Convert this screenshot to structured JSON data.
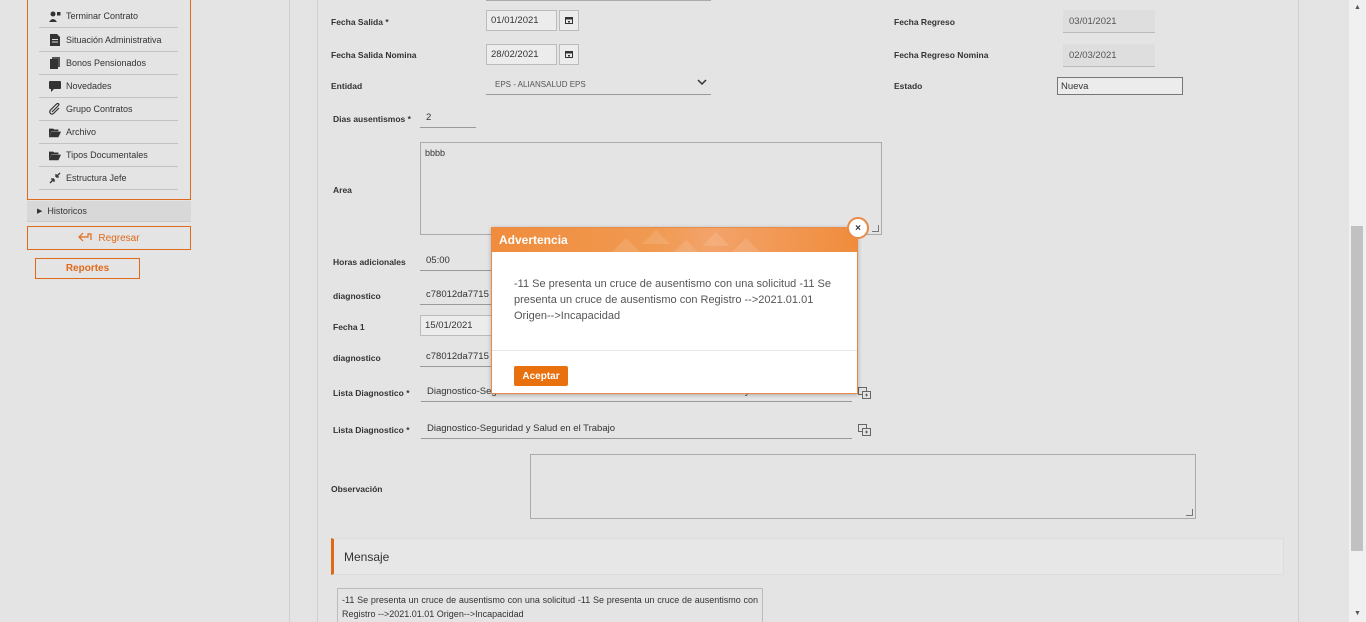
{
  "sidebar": {
    "items": [
      {
        "label": "Terminar Contrato",
        "icon": "person-remove-icon"
      },
      {
        "label": "Situación Administrativa",
        "icon": "document-icon"
      },
      {
        "label": "Bonos Pensionados",
        "icon": "bonds-icon"
      },
      {
        "label": "Novedades",
        "icon": "comment-icon"
      },
      {
        "label": "Grupo Contratos",
        "icon": "paperclip-icon"
      },
      {
        "label": "Archivo",
        "icon": "folder-open-icon"
      },
      {
        "label": "Tipos Documentales",
        "icon": "folder-open-icon"
      },
      {
        "label": "Estructura Jefe",
        "icon": "compress-icon"
      }
    ],
    "historicos": "Historicos",
    "regresar": "Regresar",
    "reportes": "Reportes"
  },
  "form": {
    "fecha_salida_label": "Fecha Salida *",
    "fecha_salida_value": "01/01/2021",
    "fecha_salida_nomina_label": "Fecha Salida Nomina",
    "fecha_salida_nomina_value": "28/02/2021",
    "fecha_regreso_label": "Fecha Regreso",
    "fecha_regreso_value": "03/01/2021",
    "fecha_regreso_nomina_label": "Fecha Regreso Nomina",
    "fecha_regreso_nomina_value": "02/03/2021",
    "entidad_label": "Entidad",
    "entidad_value": "EPS - ALIANSALUD EPS",
    "estado_label": "Estado",
    "estado_value": "Nueva",
    "dias_label": "Dias ausentismos *",
    "dias_value": "2",
    "area_label": "Area",
    "area_value": "bbbb",
    "horas_label": "Horas adicionales",
    "horas_value": "05:00",
    "diagnostico1_label": "diagnostico",
    "diagnostico1_value": "c78012da7715",
    "fecha1_label": "Fecha 1",
    "fecha1_value": "15/01/2021",
    "diagnostico2_label": "diagnostico",
    "diagnostico2_value": "c78012da7715",
    "lista1_label": "Lista Diagnostico *",
    "lista1_value": "Diagnostico-Seg",
    "lista1_value_tail": "y",
    "lista2_label": "Lista Diagnostico *",
    "lista2_value": "Diagnostico-Seguridad y Salud en el Trabajo",
    "observacion_label": "Observación"
  },
  "mensaje": {
    "title": "Mensaje",
    "text": "-11 Se presenta un cruce de ausentismo con una solicitud -11 Se presenta un cruce de ausentismo con    Registro -->2021.01.01     Origen-->Incapacidad"
  },
  "modal": {
    "title": "Advertencia",
    "body": "-11 Se presenta un cruce de ausentismo con una solicitud -11 Se presenta un cruce de ausentismo con Registro -->2021.01.01 Origen-->Incapacidad",
    "accept": "Aceptar",
    "close_glyph": "×"
  },
  "colors": {
    "accent": "#e06a1b",
    "modal_header": "#f08c3c",
    "button": "#e8700f"
  }
}
